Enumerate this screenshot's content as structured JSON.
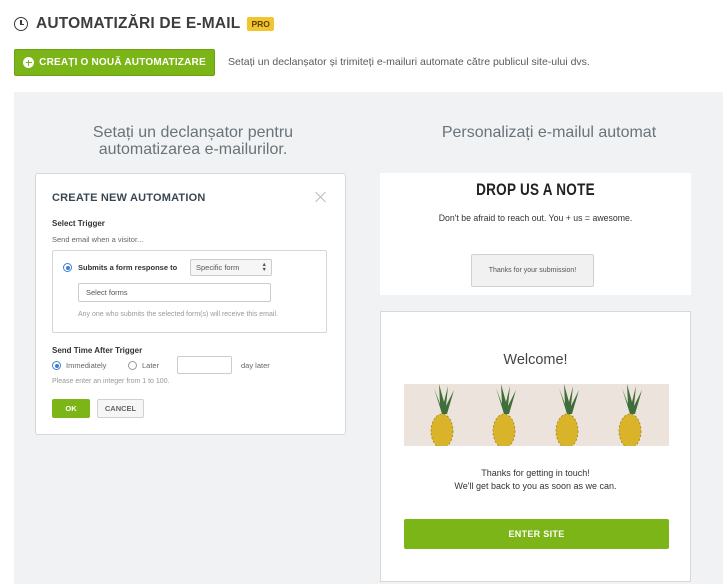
{
  "header": {
    "icon": "clock-icon",
    "title": "AUTOMATIZĂRI DE E-MAIL",
    "badge": "PRO",
    "badge_color": "#f2c530"
  },
  "create": {
    "button_label": "CREAȚI O NOUĂ AUTOMATIZARE",
    "button_icon": "plus-circle-icon",
    "description": "Setați un declanșator și trimiteți e-mailuri automate către publicul site-ului dvs."
  },
  "panel": {
    "left_heading": "Setați un declanșator pentru automatizarea e-mailurilor.",
    "right_heading": "Personalizați e-mailul automat"
  },
  "modal": {
    "title": "CREATE NEW AUTOMATION",
    "close_icon": "close-icon",
    "select_trigger_label": "Select Trigger",
    "send_when": "Send email when a visitor...",
    "submits_label": "Submits a form response to",
    "form_select_value": "Specific form",
    "forms_input_value": "Select forms",
    "forms_hint": "Any one who submits the selected form(s) will receive this email.",
    "send_time_label": "Send Time After Trigger",
    "immediately_label": "Immediately",
    "later_label": "Later",
    "days_value": "",
    "day_later_label": "day later",
    "integer_hint": "Please enter an integer  from 1 to 100.",
    "ok_label": "OK",
    "cancel_label": "CANCEL",
    "selected_send_time": "Immediately"
  },
  "preview_form": {
    "title": "DROP US A NOTE",
    "subtitle": "Don't be afraid to reach out. You + us = awesome.",
    "button_label": "Thanks for your submission!"
  },
  "preview_email": {
    "welcome": "Welcome!",
    "line1": "Thanks for getting in touch!",
    "line2": "We'll get back to you as soon as we can.",
    "button_label": "ENTER SITE",
    "accent_color": "#7cb518"
  }
}
